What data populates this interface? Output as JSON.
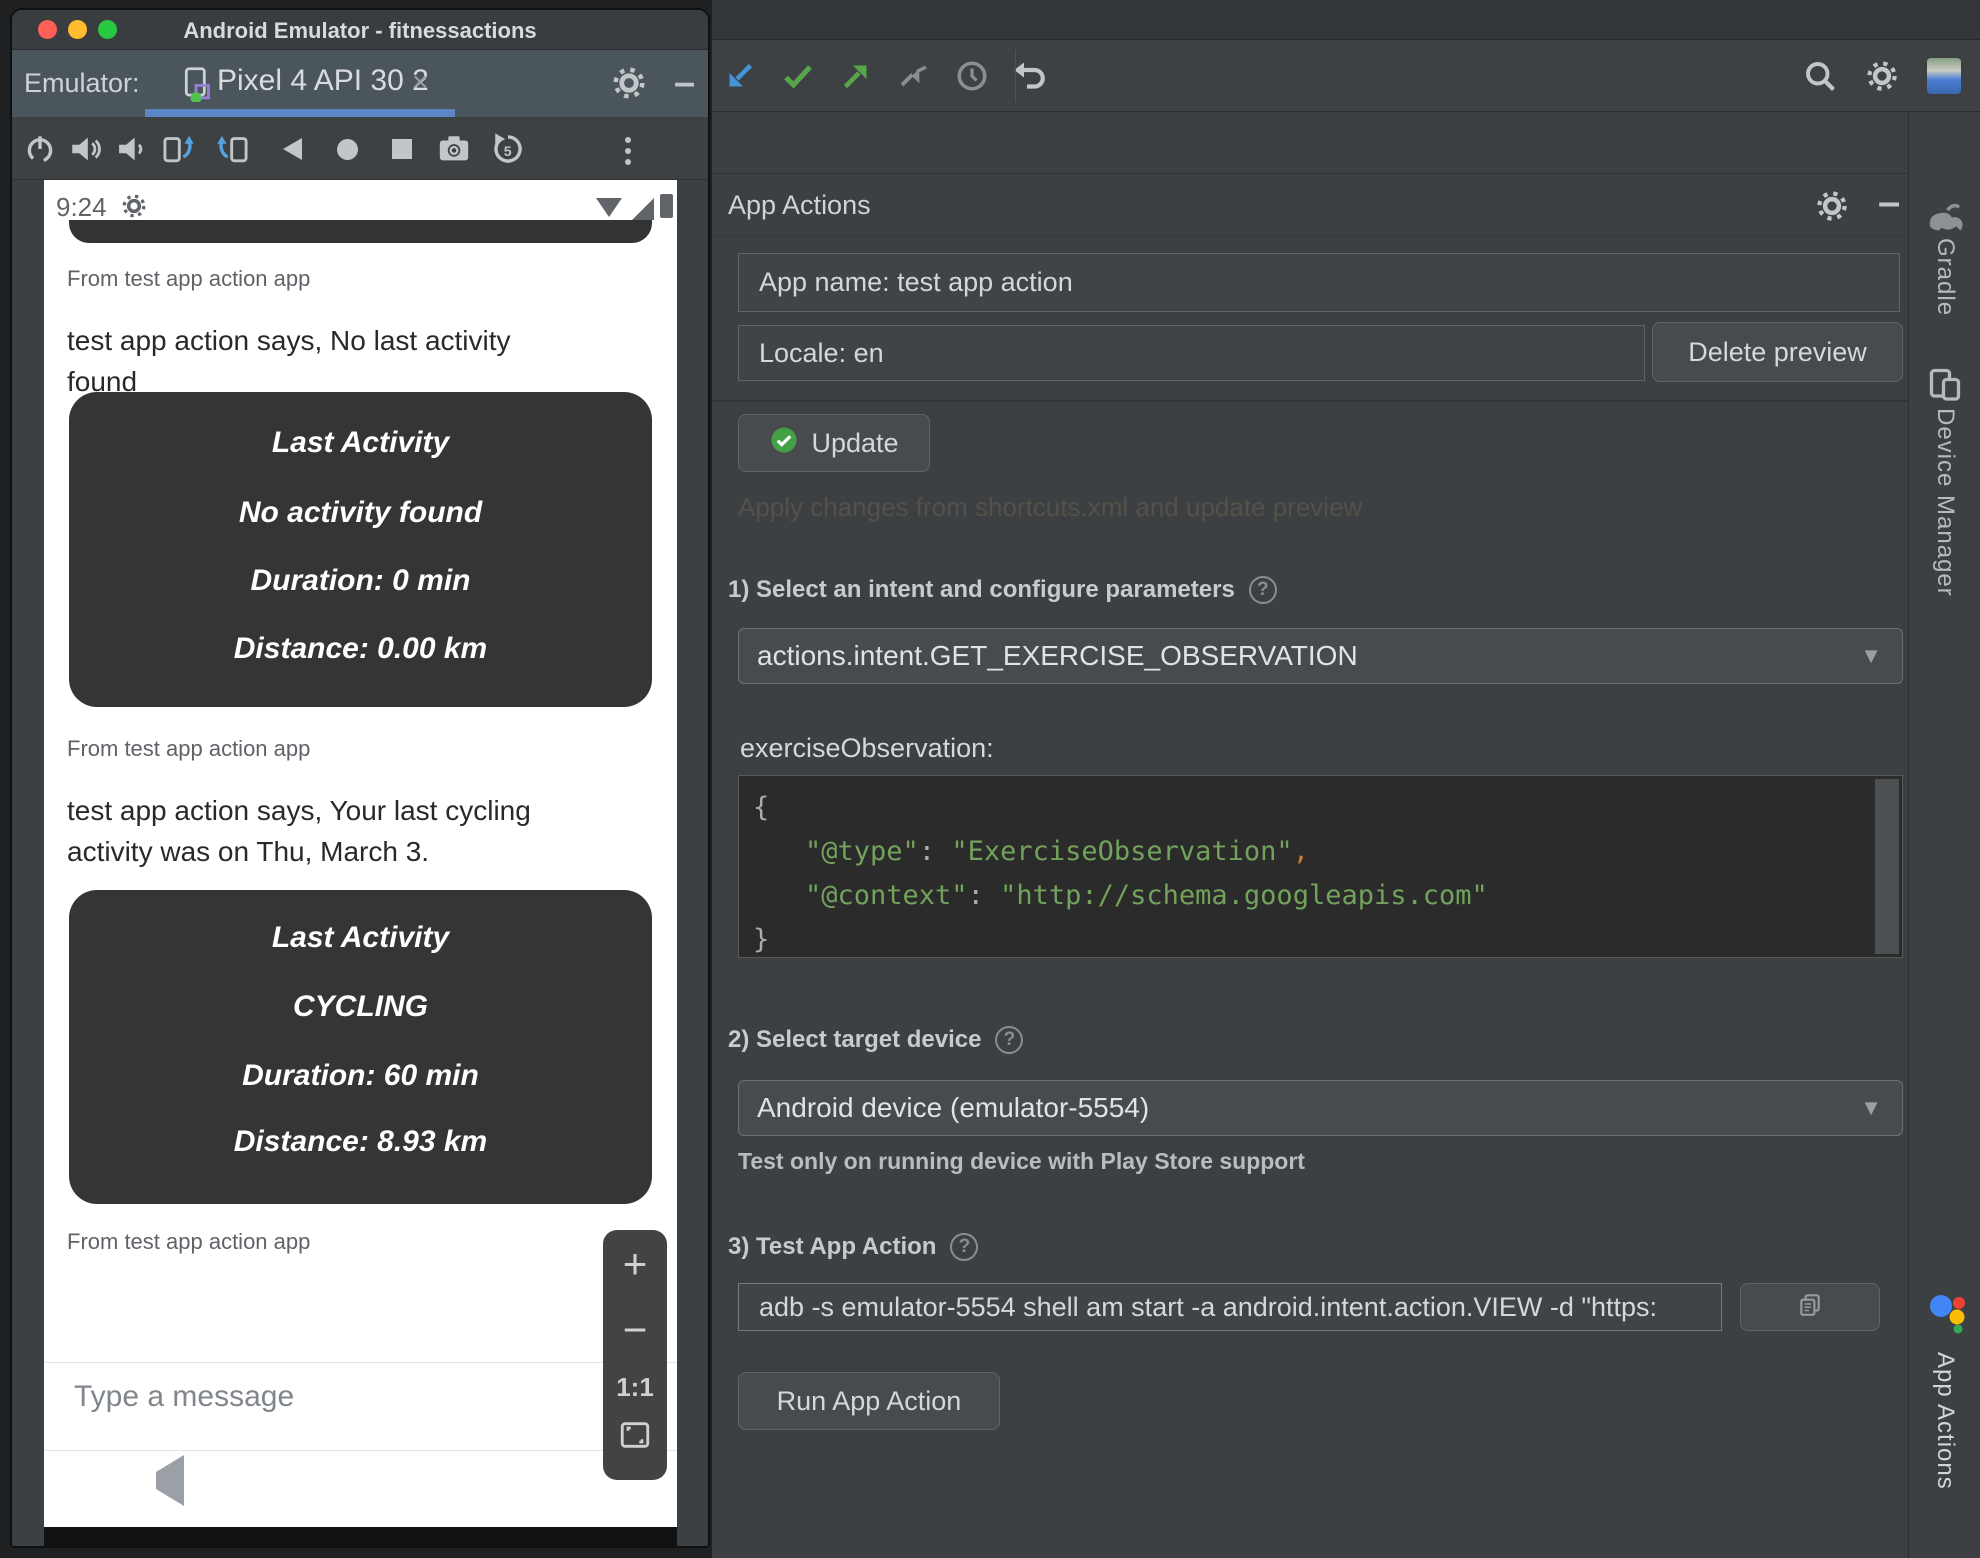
{
  "icons": {
    "caret_down": "▼",
    "help": "?",
    "plus": "+",
    "minus": "−",
    "one_to_one": "1:1",
    "tab_close": "×"
  },
  "colors": {
    "traffic_close": "#ff5f57",
    "traffic_min": "#febc2e",
    "traffic_zoom": "#28c840",
    "tab_accent": "#5c86c5",
    "json_string": "#72a25c",
    "json_comma": "#cc7832",
    "update_check": "#43a047"
  },
  "emulator": {
    "window_title": "Android Emulator - fitnessactions",
    "tab_bar": {
      "label": "Emulator:",
      "device_tab": "Pixel 4 API 30 2"
    },
    "phone": {
      "status_time": "9:24",
      "sender_label": "From test app action app",
      "message1": "test app action says, No last activity found",
      "message2": "test app action says, Your last cycling activity was on Thu, March 3.",
      "card1": {
        "title": "Last Activity",
        "activity": "No activity found",
        "duration": "Duration: 0 min",
        "distance": "Distance: 0.00 km"
      },
      "card2": {
        "title": "Last Activity",
        "activity": "CYCLING",
        "duration": "Duration: 60 min",
        "distance": "Distance: 8.93 km"
      },
      "input_placeholder": "Type a message"
    }
  },
  "studio": {
    "panel_title": "App Actions",
    "app_name_value": "App name: test app action",
    "locale_value": "Locale: en",
    "delete_preview_label": "Delete preview",
    "update_label": "Update",
    "dim_hint": "Apply changes from shortcuts.xml and update preview",
    "section1_label": "1) Select an intent and configure parameters",
    "intent_value": "actions.intent.GET_EXERCISE_OBSERVATION",
    "exercise_observation_label": "exerciseObservation:",
    "json_block": {
      "open": "{",
      "type_key": "\"@type\"",
      "colon": ":",
      "type_value": "\"ExerciseObservation\"",
      "comma": ",",
      "context_key": "\"@context\"",
      "context_value": "\"http://schema.googleapis.com\"",
      "close": "}"
    },
    "section2_label": "2) Select target device",
    "device_value": "Android device (emulator-5554)",
    "device_helper": "Test only on running device with Play Store support",
    "section3_label": "3) Test App Action",
    "command_value": "adb -s emulator-5554 shell am start -a android.intent.action.VIEW -d \"https:",
    "run_label": "Run App Action",
    "sidebar": {
      "gradle": "Gradle",
      "device_manager": "Device Manager",
      "app_actions": "App Actions"
    }
  }
}
